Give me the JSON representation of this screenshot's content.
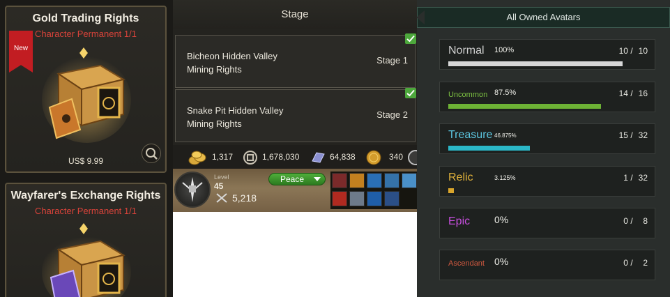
{
  "shop": {
    "cards": [
      {
        "title": "Gold Trading Rights",
        "subtitle": "Character Permanent 1/1",
        "badge": "New",
        "price": "US$ 9.99"
      },
      {
        "title": "Wayfarer's Exchange Rights",
        "subtitle": "Character Permanent 1/1"
      }
    ]
  },
  "stage": {
    "header": "Stage",
    "rows": [
      {
        "name_line1": "Bicheon Hidden Valley",
        "name_line2": "Mining Rights",
        "stage": "Stage 1"
      },
      {
        "name_line1": "Snake Pit Hidden Valley",
        "name_line2": "Mining Rights",
        "stage": "Stage 2"
      }
    ]
  },
  "currency": [
    {
      "icon": "gold-coins-icon",
      "value": "1,317"
    },
    {
      "icon": "copper-coin-icon",
      "value": "1,678,030"
    },
    {
      "icon": "silver-ingot-icon",
      "value": "64,838"
    },
    {
      "icon": "gold-medal-icon",
      "value": "340"
    }
  ],
  "hud": {
    "level_label": "Level",
    "level": "45",
    "power": "5,218",
    "mode": "Peace"
  },
  "avatars": {
    "header": "All Owned Avatars",
    "grades": [
      {
        "name": "Normal",
        "pct": "100%",
        "owned": "10",
        "total": "10",
        "fill": 1.0,
        "color": "#cfcfcf",
        "bar_color": "#d8d8d8"
      },
      {
        "name": "Uncommon",
        "pct": "87.5%",
        "owned": "14",
        "total": "16",
        "fill": 0.875,
        "color": "#7dc242",
        "bar_color": "#6db235"
      },
      {
        "name": "Treasure",
        "pct": "46.875%",
        "owned": "15",
        "total": "32",
        "fill": 0.46875,
        "color": "#5cc6e0",
        "bar_color": "#2bb7c7"
      },
      {
        "name": "Relic",
        "pct": "3.125%",
        "owned": "1",
        "total": "32",
        "fill": 0.03125,
        "color": "#e3b33b",
        "bar_color": "#d9a52c"
      },
      {
        "name": "Epic",
        "pct": "0%",
        "owned": "0",
        "total": "8",
        "fill": 0,
        "color": "#c94fe0",
        "bar_color": "#c94fe0"
      },
      {
        "name": "Ascendant",
        "pct": "0%",
        "owned": "0",
        "total": "2",
        "fill": 0,
        "color": "#d45a40",
        "bar_color": "#d45a40"
      }
    ]
  }
}
